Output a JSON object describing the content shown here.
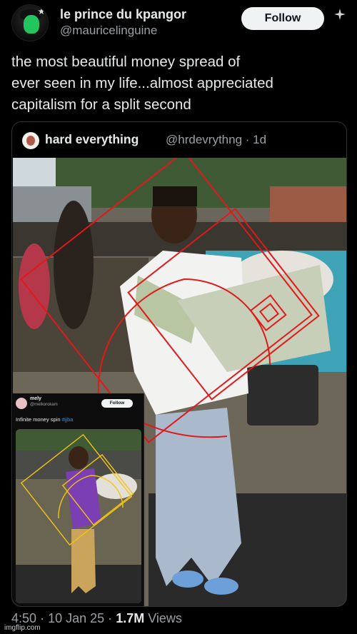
{
  "post": {
    "display_name": "le prince du kpangor",
    "handle": "@mauricelinguine",
    "follow_label": "Follow",
    "text_lines": [
      "the most beautiful money spread of",
      "ever seen in my life...almost appreciated",
      "capitalism for a split second"
    ]
  },
  "quote": {
    "display_name": "hard everything",
    "handle_time": "@hrdevrythng · 1d"
  },
  "inner_post": {
    "display_name": "mely",
    "handle": "@melkorokam",
    "follow_label": "Follow",
    "text": "Infinite money spin ",
    "hashtag": "#jjba"
  },
  "meta": {
    "time": "4:50",
    "date": "10 Jan 25",
    "views_count": "1.7M",
    "views_label": "Views",
    "separator": "·"
  },
  "watermark": "imgflip.com",
  "colors": {
    "background": "#000000",
    "text_primary": "#e7e9ea",
    "text_secondary": "#9aa0a6",
    "link": "#1d9bf0",
    "golden_spiral": "#e0191b",
    "golden_spiral_inner": "#f0c419"
  }
}
